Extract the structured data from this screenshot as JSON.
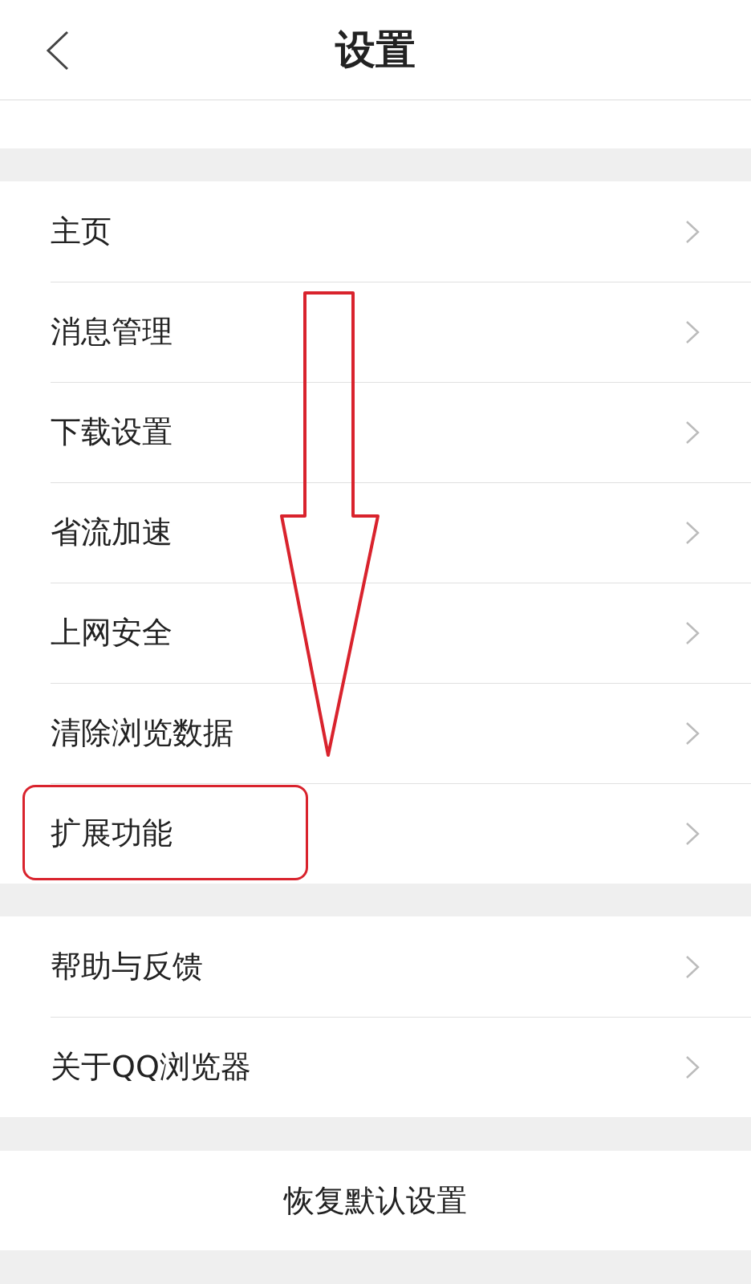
{
  "header": {
    "title": "设置"
  },
  "groups": [
    {
      "items": [
        {
          "label": "主页",
          "highlighted": false
        },
        {
          "label": "消息管理",
          "highlighted": false
        },
        {
          "label": "下载设置",
          "highlighted": false
        },
        {
          "label": "省流加速",
          "highlighted": false
        },
        {
          "label": "上网安全",
          "highlighted": false
        },
        {
          "label": "清除浏览数据",
          "highlighted": false
        },
        {
          "label": "扩展功能",
          "highlighted": true
        }
      ]
    },
    {
      "items": [
        {
          "label": "帮助与反馈",
          "highlighted": false
        },
        {
          "label": "关于QQ浏览器",
          "highlighted": false
        }
      ]
    }
  ],
  "reset_button": {
    "label": "恢复默认设置"
  }
}
